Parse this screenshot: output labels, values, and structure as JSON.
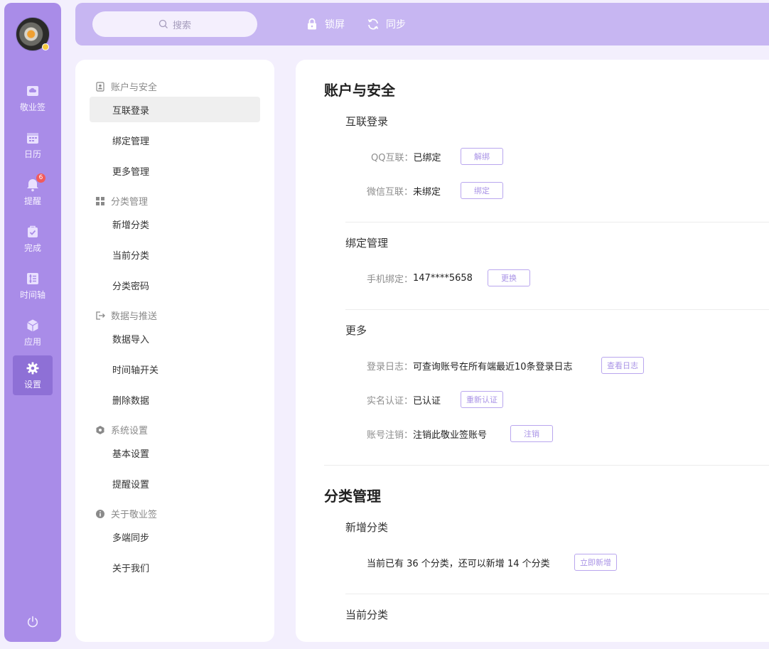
{
  "rail": {
    "items": [
      {
        "label": "敬业签",
        "icon": "cloud-note-icon"
      },
      {
        "label": "日历",
        "icon": "calendar-icon"
      },
      {
        "label": "提醒",
        "icon": "bell-icon",
        "badge": "6"
      },
      {
        "label": "完成",
        "icon": "check-bag-icon"
      },
      {
        "label": "时间轴",
        "icon": "timeline-icon"
      },
      {
        "label": "应用",
        "icon": "cube-icon"
      },
      {
        "label": "设置",
        "icon": "gear-icon",
        "active": true
      }
    ],
    "power_icon": "power-icon"
  },
  "topbar": {
    "search_placeholder": "搜索",
    "lock_label": "锁屏",
    "sync_label": "同步"
  },
  "nav": {
    "groups": [
      {
        "title": "账户与安全",
        "items": [
          "互联登录",
          "绑定管理",
          "更多管理"
        ]
      },
      {
        "title": "分类管理",
        "items": [
          "新增分类",
          "当前分类",
          "分类密码"
        ]
      },
      {
        "title": "数据与推送",
        "items": [
          "数据导入",
          "时间轴开关",
          "删除数据"
        ]
      },
      {
        "title": "系统设置",
        "items": [
          "基本设置",
          "提醒设置"
        ]
      },
      {
        "title": "关于敬业签",
        "items": [
          "多端同步",
          "关于我们"
        ]
      }
    ],
    "active_item": "互联登录"
  },
  "content": {
    "account_title": "账户与安全",
    "login_section": "互联登录",
    "qq_label": "QQ互联：",
    "qq_value": "已绑定",
    "qq_btn": "解绑",
    "wechat_label": "微信互联：",
    "wechat_value": "未绑定",
    "wechat_btn": "绑定",
    "bind_section": "绑定管理",
    "phone_label": "手机绑定：",
    "phone_value": "147****5658",
    "phone_btn": "更换",
    "more_section": "更多",
    "log_label": "登录日志：",
    "log_value": "可查询账号在所有端最近10条登录日志",
    "log_btn": "查看日志",
    "realname_label": "实名认证：",
    "realname_value": "已认证",
    "realname_btn": "重新认证",
    "cancel_label": "账号注销：",
    "cancel_value": "注销此敬业签账号",
    "cancel_btn": "注销",
    "category_title": "分类管理",
    "new_category_section": "新增分类",
    "category_info": "当前已有 36 个分类，还可以新增 14 个分类",
    "new_category_btn": "立即新增",
    "current_category_section": "当前分类"
  },
  "colors": {
    "rail": "#a98ce8",
    "rail_active": "#8e70d6",
    "topbar": "#c7b6f2",
    "accent": "#a993e6",
    "background": "#f3effd",
    "badge": "#f25b5b"
  }
}
